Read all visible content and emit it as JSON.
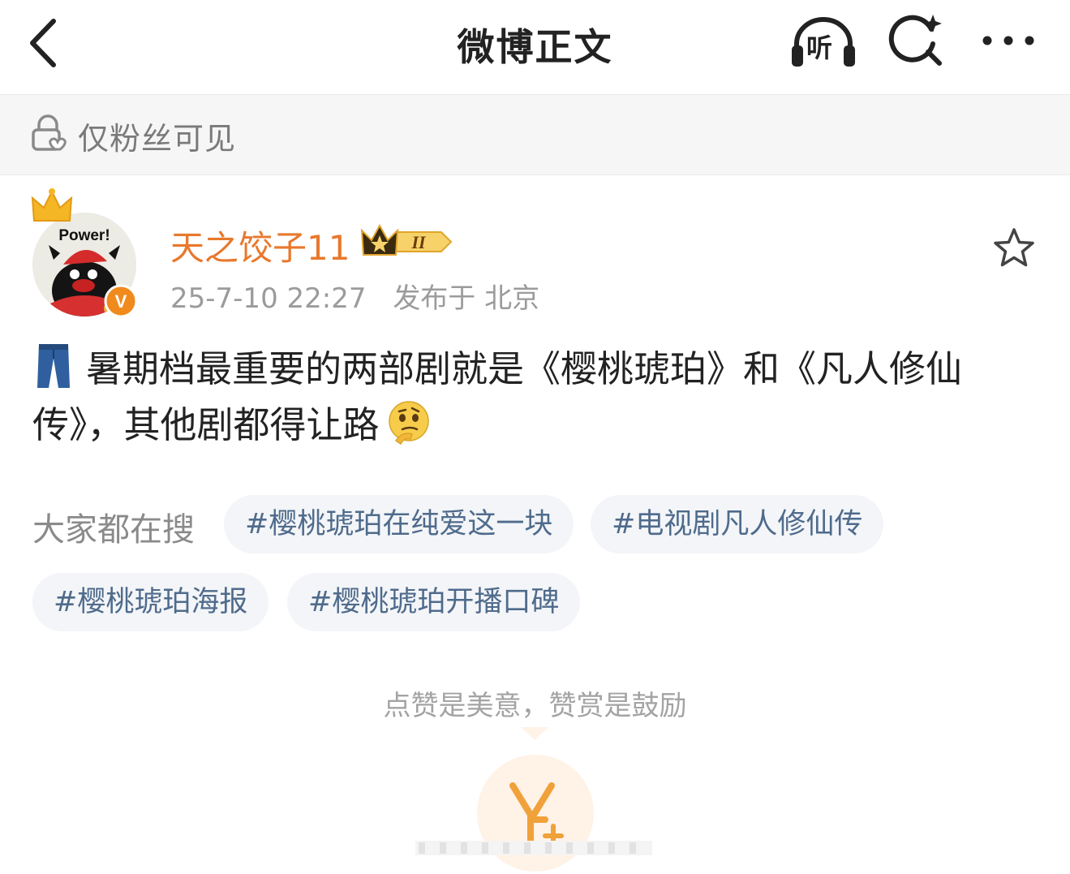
{
  "nav": {
    "title": "微博正文",
    "listen_label": "听"
  },
  "visibility": {
    "text": "仅粉丝可见"
  },
  "author": {
    "name": "天之饺子11",
    "vip_level": "II",
    "avatar_text": "Power!",
    "verified_badge": "V",
    "date": "25-7-10 22:27",
    "published_in": "发布于 北京"
  },
  "post": {
    "line1": "暑期档最重要的两部剧就是《樱桃琥珀》和《凡人修仙",
    "line2": "传》，其他剧都得让路",
    "emojis": [
      "jeans-emoji",
      "thinking-face-emoji"
    ]
  },
  "trending": {
    "label": "大家都在搜",
    "tags": [
      "#樱桃琥珀在纯爱这一块",
      "#电视剧凡人修仙传",
      "#樱桃琥珀海报",
      "#樱桃琥珀开播口碑"
    ]
  },
  "reward": {
    "text": "点赞是美意，赞赏是鼓励"
  },
  "colors": {
    "author_name": "#e8782d",
    "tag_text": "#4f6b8c",
    "tag_bg": "#f3f5f8",
    "meta_text": "#9b9b9b",
    "reward_bg": "#fff2e6",
    "reward_icon": "#f0a13a"
  }
}
